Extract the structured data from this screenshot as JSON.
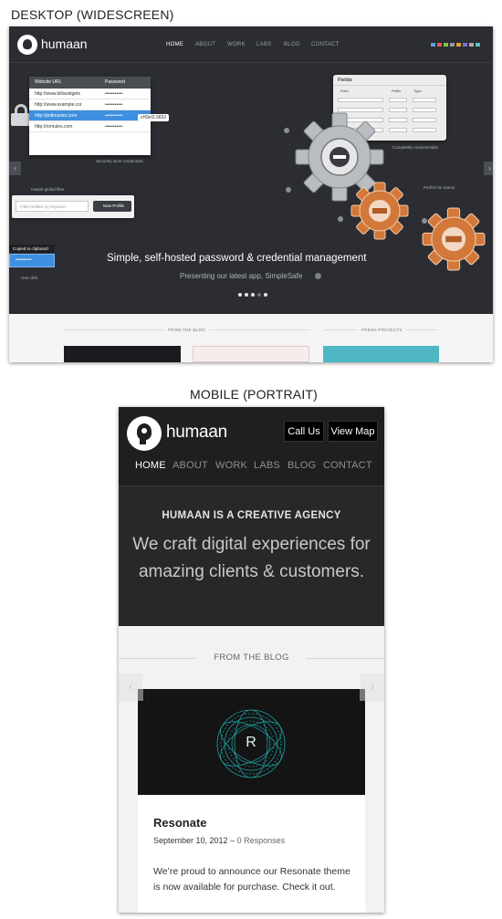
{
  "captions": {
    "desktop": "DESKTOP (WIDESCREEN)",
    "mobile": "MOBILE (PORTRAIT)"
  },
  "colors": {
    "header_dark": "#1f1f1f",
    "hero_dark": "#282828",
    "desktop_hero": "#2b2d32",
    "accent_blue": "#3f8fe0",
    "gear_orange": "#d2783a",
    "page_bg": "#f2f2f2"
  },
  "desktop": {
    "logo_text": "humaan",
    "nav": [
      {
        "label": "HOME",
        "active": true
      },
      {
        "label": "ABOUT",
        "active": false
      },
      {
        "label": "WORK",
        "active": false
      },
      {
        "label": "LABS",
        "active": false
      },
      {
        "label": "BLOG",
        "active": false
      },
      {
        "label": "CONTACT",
        "active": false
      }
    ],
    "social_text": "SOCIAL ICONS",
    "password_table": {
      "headers": [
        "Website URL",
        "Password"
      ],
      "rows": [
        {
          "url": "http://www.billswidgets",
          "pw": "•••••••••••",
          "selected": false
        },
        {
          "url": "http://www.example.cor",
          "pw": "•••••••••••",
          "selected": false
        },
        {
          "url": "http://jedimaster.com",
          "pw": "•••••••••••",
          "selected": true
        },
        {
          "url": "http://ronrules.com",
          "pw": "•••••••••••",
          "selected": false
        }
      ]
    },
    "tooltip": "cH3el3.9653",
    "note_secure": "Securely store credentials",
    "filter_label": "Instant global filter",
    "filter_placeholder": "Filter profiles by keyword",
    "new_profile_label": "New Profile",
    "copied_label": "Copied to clipboard",
    "one_click_value": "••••••••••",
    "one_click_label": "One click",
    "fields_panel": {
      "title": "Fields",
      "col_headers": [
        "Field",
        "Prefix",
        "Type"
      ],
      "row_labels": [
        "Username",
        "Password",
        "Website",
        "Notes"
      ]
    },
    "note_customizable": "Completely customizable",
    "note_teams": "Perfect for teams",
    "headline": "Simple, self-hosted password & credential management",
    "subline": "Presenting our latest app, SimpleSafe",
    "carousel": {
      "count": 5,
      "active_index": 3
    },
    "section_blog": "FROM THE BLOG",
    "section_projects": "FRESH PROJECTS"
  },
  "mobile": {
    "logo_text": "humaan",
    "call_button": "Call Us",
    "map_button": "View Map",
    "nav": [
      {
        "label": "HOME",
        "active": true
      },
      {
        "label": "ABOUT",
        "active": false
      },
      {
        "label": "WORK",
        "active": false
      },
      {
        "label": "LABS",
        "active": false
      },
      {
        "label": "BLOG",
        "active": false
      },
      {
        "label": "CONTACT",
        "active": false
      }
    ],
    "kicker": "HUMAAN IS A CREATIVE AGENCY",
    "tagline_line1": "We craft digital experiences for",
    "tagline_line2": "amazing clients & customers.",
    "blog_heading": "FROM THE BLOG",
    "post": {
      "image_letter": "R",
      "title": "Resonate",
      "date": "September 10, 2012",
      "separator": " – ",
      "responses": "0 Responses",
      "excerpt": "We’re proud to announce our Resonate theme is now available for purchase. Check it out."
    }
  }
}
